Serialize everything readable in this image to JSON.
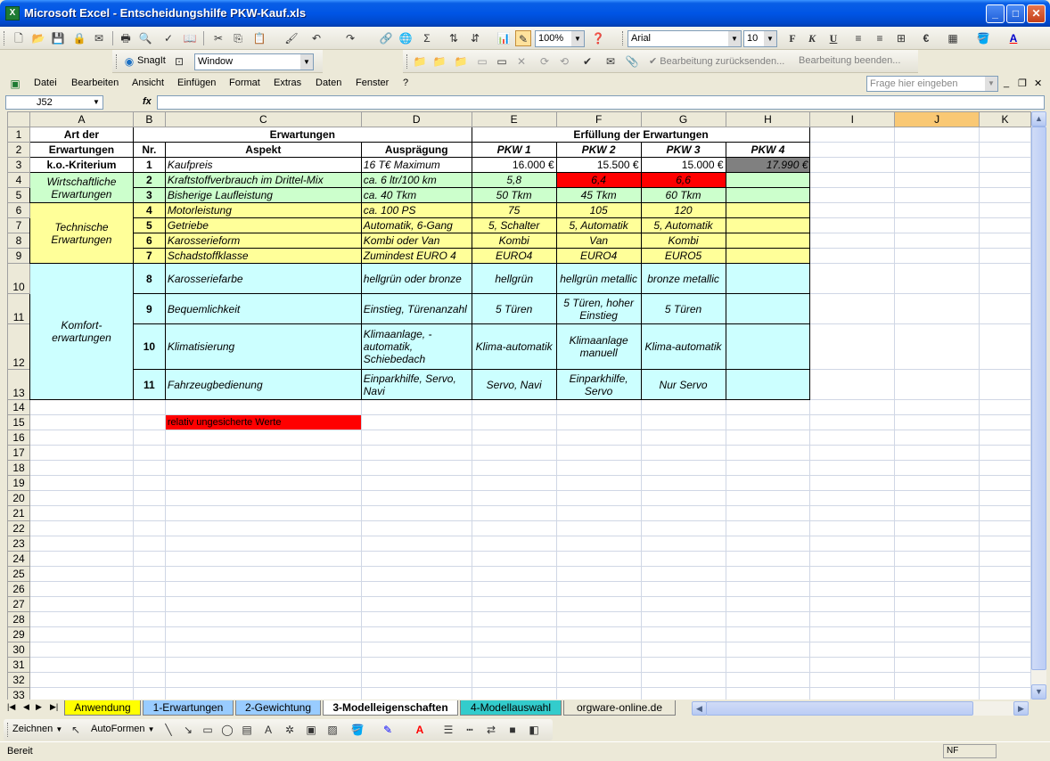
{
  "window": {
    "title": "Microsoft Excel - Entscheidungshilfe PKW-Kauf.xls"
  },
  "toolbar": {
    "zoom": "100%",
    "font": "Arial",
    "font_size": "10",
    "snagit_label": "SnagIt",
    "snagit_window": "Window",
    "review_reply": "Bearbeitung zurücksenden...",
    "review_end": "Bearbeitung beenden..."
  },
  "menu": [
    "Datei",
    "Bearbeiten",
    "Ansicht",
    "Einfügen",
    "Format",
    "Extras",
    "Daten",
    "Fenster",
    "?"
  ],
  "help_placeholder": "Frage hier eingeben",
  "namebox": "J52",
  "columns": [
    "A",
    "B",
    "C",
    "D",
    "E",
    "F",
    "G",
    "H",
    "I",
    "J",
    "K"
  ],
  "rows_empty": [
    "14",
    "16",
    "17",
    "18",
    "19",
    "20",
    "21",
    "22",
    "23",
    "24",
    "25",
    "26",
    "27",
    "28",
    "29",
    "30",
    "31",
    "32",
    "33"
  ],
  "sheet": {
    "r1": {
      "a": "Art der",
      "c": "Erwartungen",
      "e": "Erfüllung der Erwartungen"
    },
    "r2": {
      "a": "Erwartungen",
      "b": "Nr.",
      "c": "Aspekt",
      "d": "Ausprägung",
      "e": "PKW 1",
      "f": "PKW 2",
      "g": "PKW 3",
      "h": "PKW 4"
    },
    "r3": {
      "a": "k.o.-Kriterium",
      "b": "1",
      "c": "Kaufpreis",
      "d": "16 T€ Maximum",
      "e": "16.000 €",
      "f": "15.500 €",
      "g": "15.000 €",
      "h": "17.990 €"
    },
    "g_wirt": "Wirtschaftliche Erwartungen",
    "r4": {
      "b": "2",
      "c": "Kraftstoffverbrauch im Drittel-Mix",
      "d": "ca. 6 ltr/100 km",
      "e": "5,8",
      "f": "6,4",
      "g": "6,6"
    },
    "r5": {
      "b": "3",
      "c": "Bisherige Laufleistung",
      "d": "ca. 40 Tkm",
      "e": "50 Tkm",
      "f": "45 Tkm",
      "g": "60 Tkm"
    },
    "g_tech": "Technische Erwartungen",
    "r6": {
      "b": "4",
      "c": "Motorleistung",
      "d": "ca. 100 PS",
      "e": "75",
      "f": "105",
      "g": "120"
    },
    "r7": {
      "b": "5",
      "c": "Getriebe",
      "d": "Automatik, 6-Gang",
      "e": "5, Schalter",
      "f": "5, Automatik",
      "g": "5, Automatik"
    },
    "r8": {
      "b": "6",
      "c": "Karosserieform",
      "d": "Kombi oder Van",
      "e": "Kombi",
      "f": "Van",
      "g": "Kombi"
    },
    "r9": {
      "b": "7",
      "c": "Schadstoffklasse",
      "d": "Zumindest EURO 4",
      "e": "EURO4",
      "f": "EURO4",
      "g": "EURO5"
    },
    "g_komf": "Komfort-erwartungen",
    "r10": {
      "b": "8",
      "c": "Karosseriefarbe",
      "d": "hellgrün oder bronze",
      "e": "hellgrün",
      "f": "hellgrün metallic",
      "g": "bronze metallic"
    },
    "r11": {
      "b": "9",
      "c": "Bequemlichkeit",
      "d": "Einstieg, Türenanzahl",
      "e": "5 Türen",
      "f": "5 Türen, hoher Einstieg",
      "g": "5 Türen"
    },
    "r12": {
      "b": "10",
      "c": "Klimatisierung",
      "d": "Klimaanlage, -automatik, Schiebedach",
      "e": "Klima-automatik",
      "f": "Klimaanlage manuell",
      "g": "Klima-automatik"
    },
    "r13": {
      "b": "11",
      "c": "Fahrzeugbedienung",
      "d": "Einparkhilfe, Servo, Navi",
      "e": "Servo, Navi",
      "f": "Einparkhilfe, Servo",
      "g": "Nur Servo"
    },
    "r15": {
      "c": "relativ ungesicherte Werte"
    }
  },
  "tabs": [
    "Anwendung",
    "1-Erwartungen",
    "2-Gewichtung",
    "3-Modelleigenschaften",
    "4-Modellauswahl",
    "orgware-online.de"
  ],
  "drawbar": {
    "draw": "Zeichnen",
    "autoshapes": "AutoFormen"
  },
  "status": {
    "text": "Bereit",
    "nf": "NF"
  },
  "colors": {
    "green": "#CCFFCC",
    "yellow": "#FFFF99",
    "cyan": "#CCFFFF",
    "red": "#FF0000",
    "gray": "#808080"
  }
}
